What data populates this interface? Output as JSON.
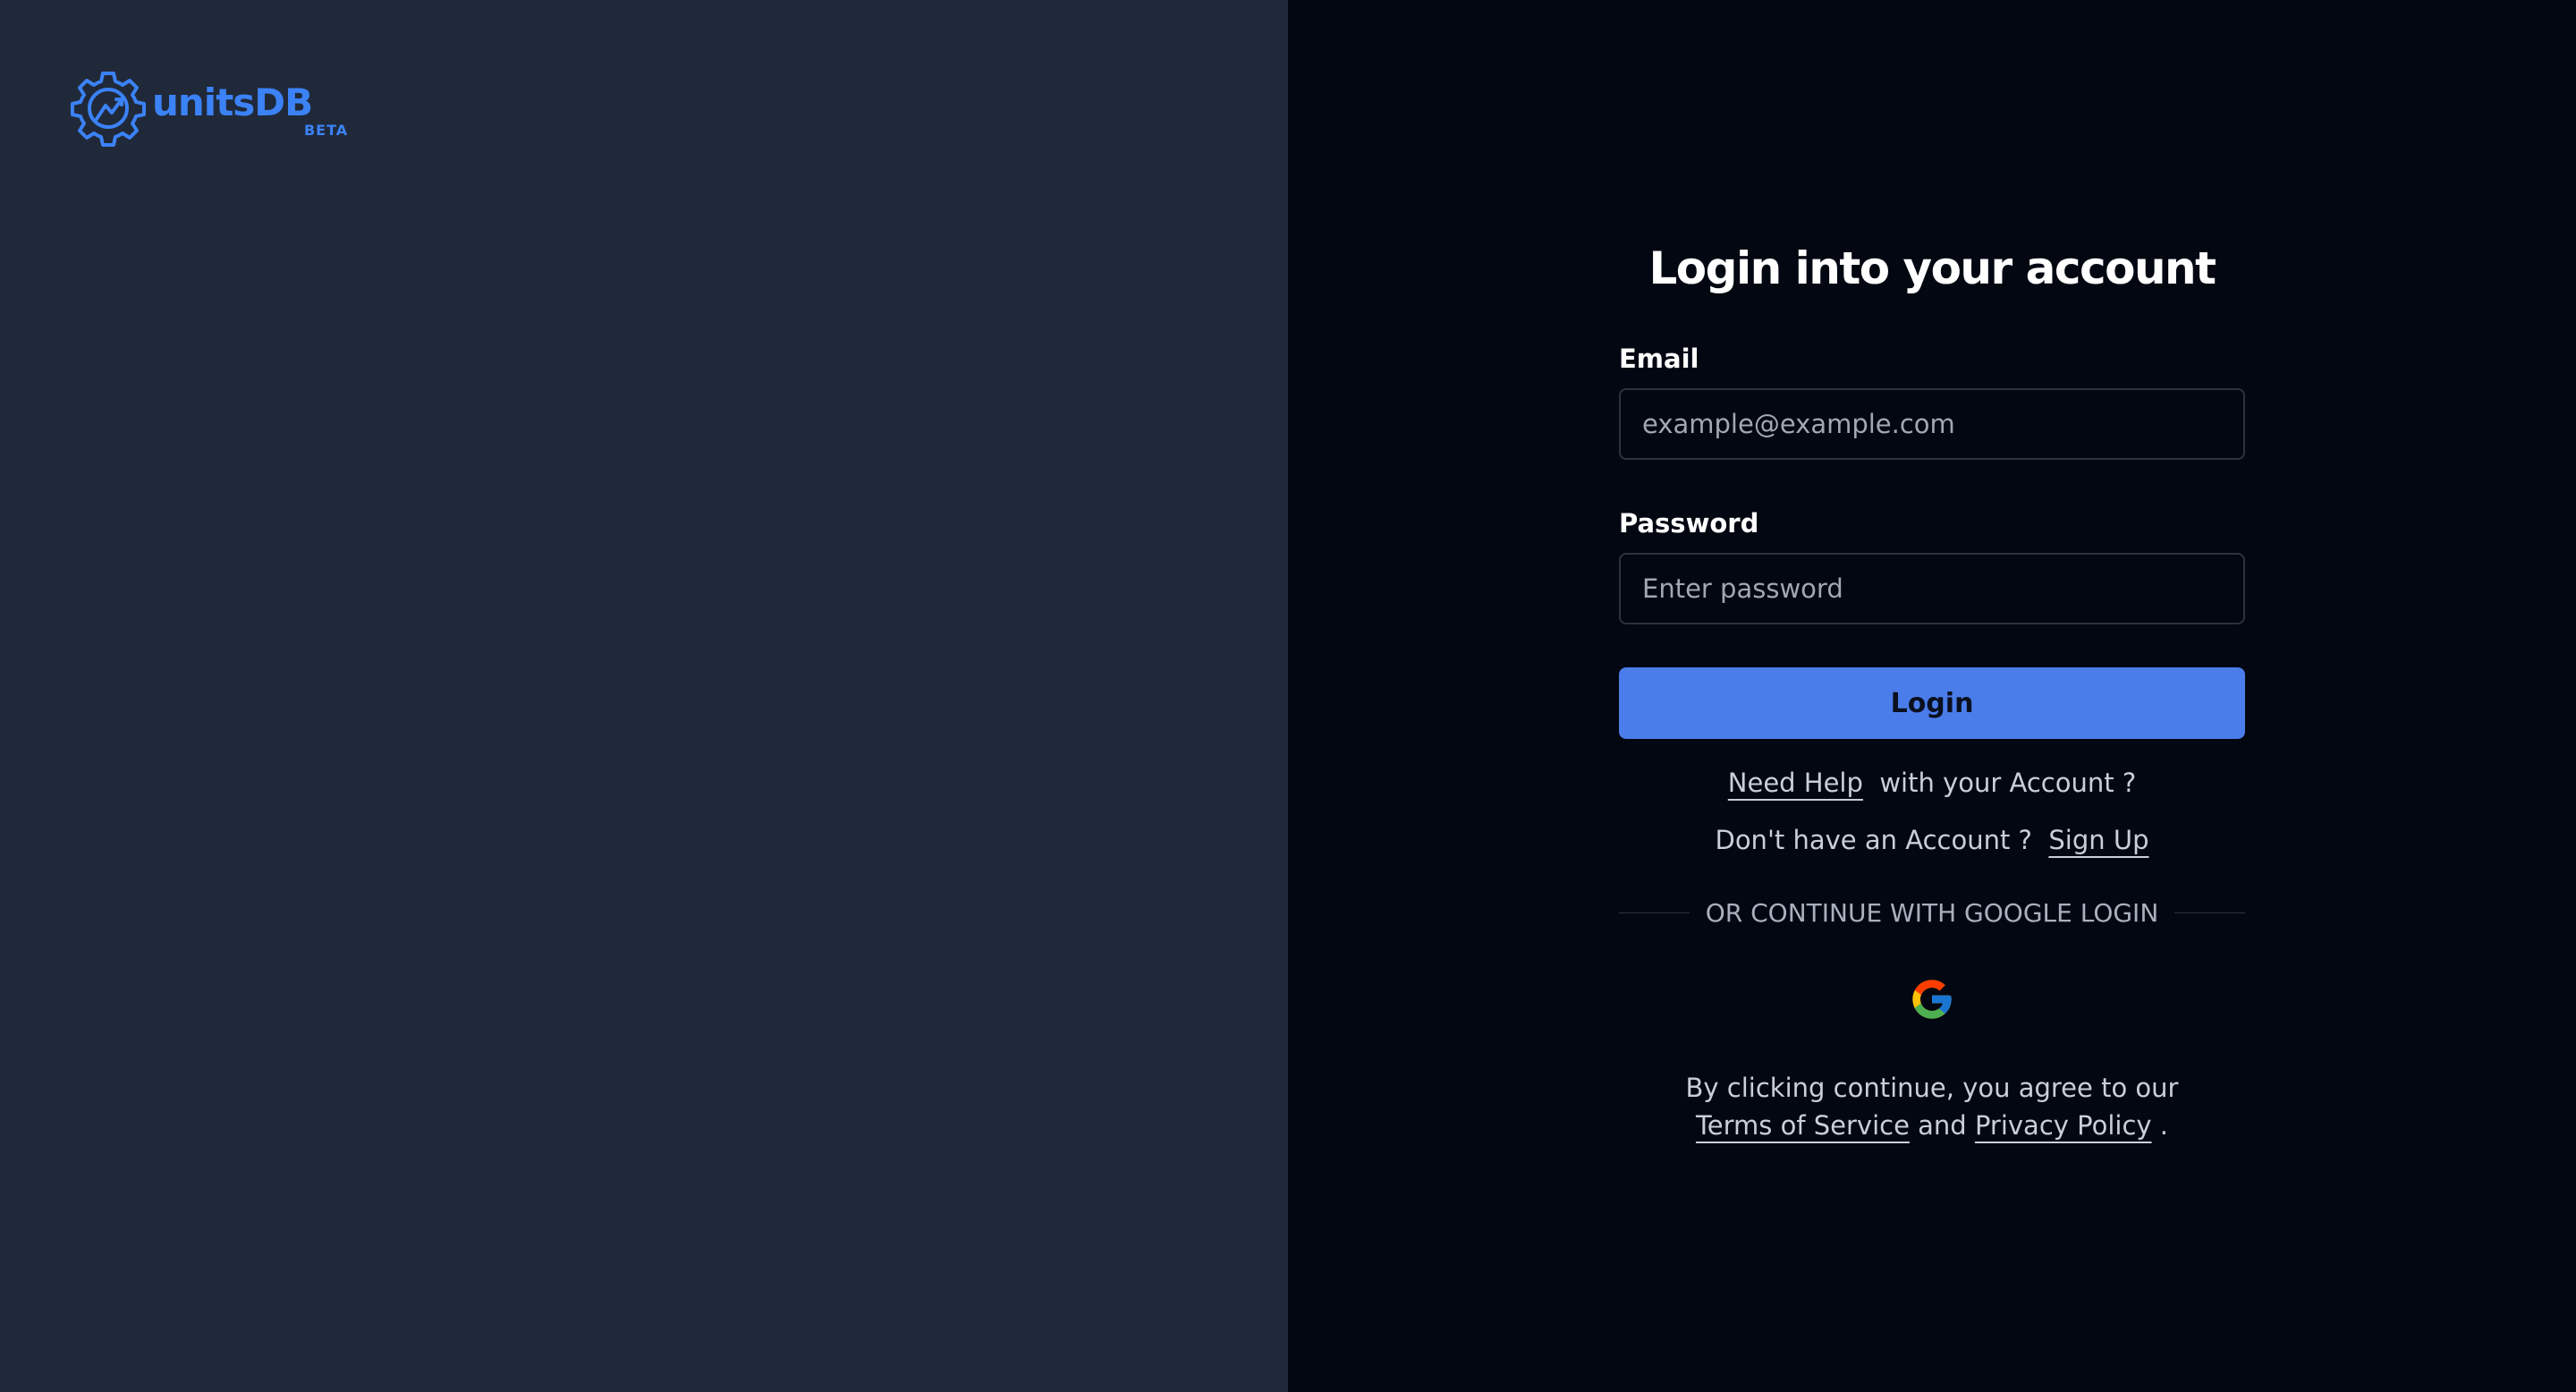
{
  "brand": {
    "name": "unitsDB",
    "badge": "BETA",
    "color": "#3b82f6"
  },
  "login": {
    "title": "Login into your account",
    "email_label": "Email",
    "email_placeholder": "example@example.com",
    "email_value": "",
    "password_label": "Password",
    "password_placeholder": "Enter password",
    "password_value": "",
    "submit_label": "Login",
    "help_link": "Need Help",
    "help_suffix": "with your Account ?",
    "signup_prefix": "Don't have an Account ?",
    "signup_link": "Sign Up",
    "divider_text": "OR CONTINUE WITH GOOGLE LOGIN",
    "google_icon": "google-icon",
    "agree_prefix": "By clicking continue, you agree to our",
    "terms_link": "Terms of Service",
    "agree_and": "and",
    "privacy_link": "Privacy Policy",
    "agree_suffix": "."
  },
  "colors": {
    "left_panel": "#202939",
    "right_panel": "#030712",
    "accent_button": "#4a7de9"
  }
}
